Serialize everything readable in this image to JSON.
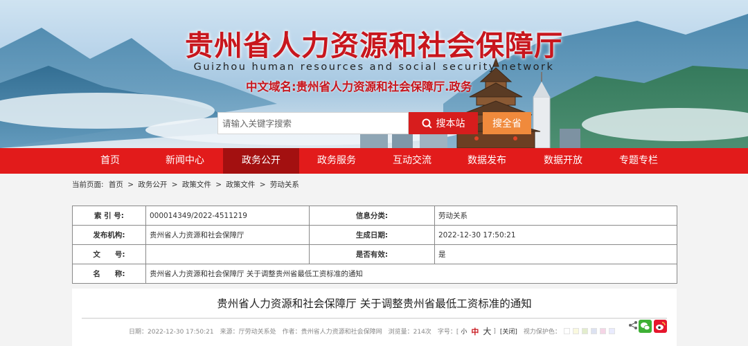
{
  "header": {
    "title": "贵州省人力资源和社会保障厅",
    "subtitle": "Guizhou human resources and social security network",
    "domain": "中文域名:贵州省人力资源和社会保障厅.政务"
  },
  "search": {
    "placeholder": "请输入关键字搜索",
    "site_label": "搜本站",
    "province_label": "搜全省"
  },
  "nav": {
    "items": [
      "首页",
      "新闻中心",
      "政务公开",
      "政务服务",
      "互动交流",
      "数据发布",
      "数据开放",
      "专题专栏"
    ],
    "active": "政务公开"
  },
  "breadcrumb": {
    "prefix": "当前页面:",
    "items": [
      "首页",
      "政务公开",
      "政策文件",
      "政策文件",
      "劳动关系"
    ],
    "separator": ">"
  },
  "info": {
    "index_label": "索 引 号:",
    "index_value": "000014349/2022-4511219",
    "category_label": "信息分类:",
    "category_value": "劳动关系",
    "publisher_label": "发布机构:",
    "publisher_value": "贵州省人力资源和社会保障厅",
    "date_label": "生成日期:",
    "date_value": "2022-12-30 17:50:21",
    "docno_label": "文　　号:",
    "docno_value": "",
    "valid_label": "是否有效:",
    "valid_value": "是",
    "name_label": "名　　称:",
    "name_value": "贵州省人力资源和社会保障厅 关于调整贵州省最低工资标准的通知"
  },
  "article": {
    "title": "贵州省人力资源和社会保障厅 关于调整贵州省最低工资标准的通知",
    "date": "日期：2022-12-30 17:50:21",
    "source": "来源：厅劳动关系处",
    "author": "作者：贵州省人力资源和社会保障网",
    "views": "浏览量：214次",
    "font_label": "字号：[",
    "font_small": "小",
    "font_medium": "中",
    "font_large": "大",
    "font_end": "]",
    "close": "[关闭]",
    "eye_label": "视力保护色：",
    "eye_colors": [
      "#ffffff",
      "#faf9de",
      "#e3edcd",
      "#dce2f1",
      "#f5d5e6",
      "#e9ebfe"
    ]
  },
  "colors": {
    "brand_red": "#c8161d",
    "nav_red": "#e21b1b",
    "nav_active": "#a31010",
    "search_orange": "#f08a3c"
  },
  "icons": {
    "search": "search-icon",
    "share": "share-icon",
    "wechat": "wechat-icon",
    "weibo": "weibo-icon"
  }
}
